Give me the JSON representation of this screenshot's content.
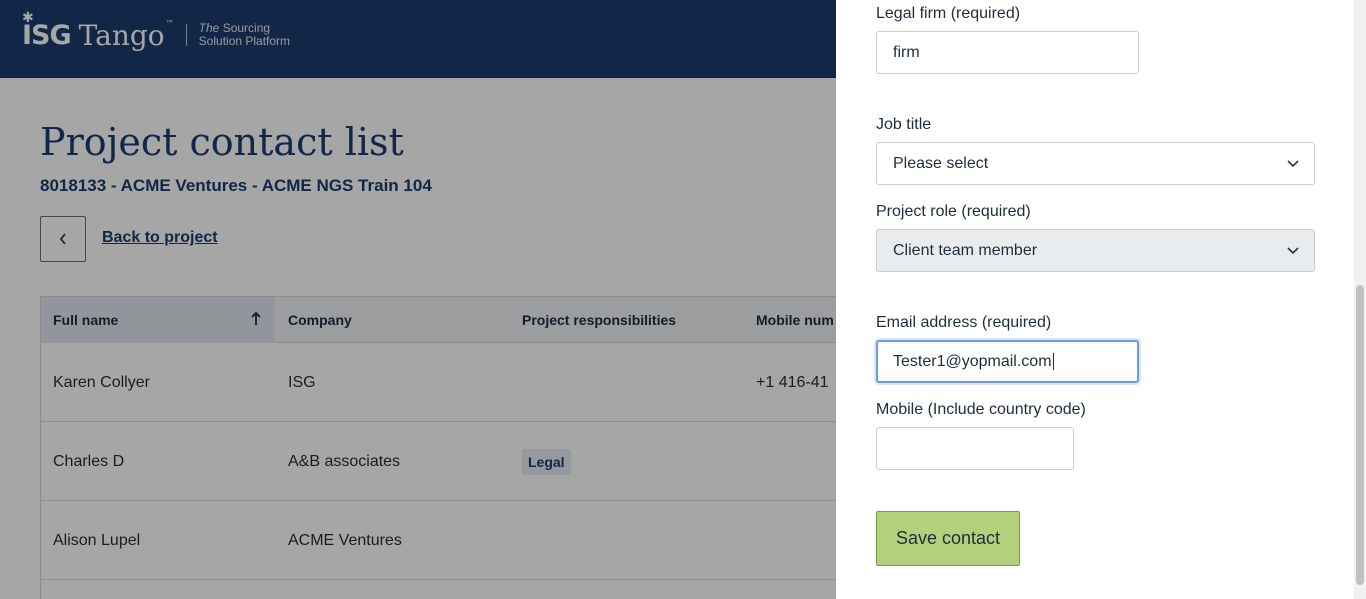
{
  "header": {
    "logo_brand": "ISG",
    "logo_product": "Tango",
    "logo_tm": "™",
    "tagline_line1_italic": "The",
    "tagline_line1_rest": " Sourcing",
    "tagline_line2": "Solution Platform",
    "bg_color": "#1c3b6e"
  },
  "page": {
    "title": "Project contact list",
    "subtitle": "8018133 - ACME Ventures - ACME NGS Train 104",
    "back_link": "Back to project"
  },
  "table": {
    "columns": [
      "Full name",
      "Company",
      "Project responsibilities",
      "Mobile num"
    ],
    "sort_column": "Full name",
    "sort_direction": "ascending",
    "rows": [
      {
        "full_name": "Karen Collyer",
        "company": "ISG",
        "responsibility": "",
        "mobile": "+1 416-41"
      },
      {
        "full_name": "Charles D",
        "company": "A&B associates",
        "responsibility": "Legal",
        "mobile": ""
      },
      {
        "full_name": "Alison Lupel",
        "company": "ACME Ventures",
        "responsibility": "",
        "mobile": ""
      }
    ]
  },
  "form": {
    "legal_firm_label": "Legal firm (required)",
    "legal_firm_value": "firm",
    "job_title_label": "Job title",
    "job_title_value": "Please select",
    "project_role_label": "Project role (required)",
    "project_role_value": "Client team member",
    "email_label": "Email address (required)",
    "email_value": "Tester1@yopmail.com",
    "mobile_label": "Mobile (Include country code)",
    "mobile_value": "",
    "save_label": "Save contact",
    "save_color": "#b3d17a"
  }
}
